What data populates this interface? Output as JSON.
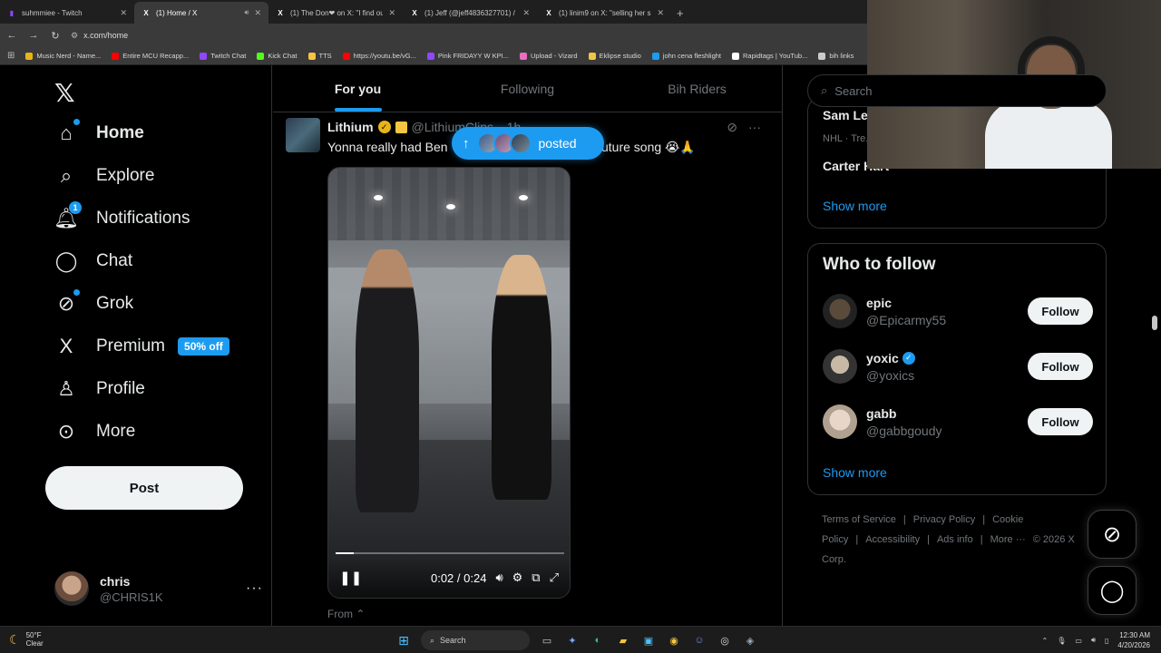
{
  "browser": {
    "tabs": [
      {
        "title": "suhmmiee - Twitch",
        "color": "#9146ff",
        "glyph": "▮"
      },
      {
        "title": "(1) Home / X",
        "color": "#ffffff",
        "glyph": "X",
        "active": true
      },
      {
        "title": "(1) The Don❤ on X: \"I find out",
        "color": "#ffffff",
        "glyph": "X"
      },
      {
        "title": "(1) Jeff (@jeff4836327701) / X",
        "color": "#ffffff",
        "glyph": "X"
      },
      {
        "title": "(1) linim9 on X: \"selling her sun",
        "color": "#ffffff",
        "glyph": "X"
      }
    ],
    "url": "x.com/home",
    "bookmarks": [
      {
        "label": "Music Nerd - Name...",
        "color": "#e8b417"
      },
      {
        "label": "Entire MCU Recapp...",
        "color": "#ff0000"
      },
      {
        "label": "Twitch Chat",
        "color": "#9146ff"
      },
      {
        "label": "Kick Chat",
        "color": "#53fc18"
      },
      {
        "label": "TTS",
        "color": "#f5c542"
      },
      {
        "label": "https://youtu.be/vG...",
        "color": "#ff0000"
      },
      {
        "label": "Pink FRIDAYY W KPI...",
        "color": "#9146ff"
      },
      {
        "label": "Upload - Vizard",
        "color": "#e86fbf"
      },
      {
        "label": "Eklipse studio",
        "color": "#f5c542"
      },
      {
        "label": "john cena fleshlight",
        "color": "#1d9bf0"
      },
      {
        "label": "Rapidtags | YouTub...",
        "color": "#ffffff"
      },
      {
        "label": "bih links",
        "color": "#cccccc"
      }
    ]
  },
  "nav": {
    "items": [
      {
        "label": "Home",
        "icon": "home-icon",
        "glyph": "⌂"
      },
      {
        "label": "Explore",
        "icon": "search-icon",
        "glyph": "⌕"
      },
      {
        "label": "Notifications",
        "icon": "bell-icon",
        "glyph": "🔔︎",
        "badge": "1"
      },
      {
        "label": "Chat",
        "icon": "chat-icon",
        "glyph": "◯"
      },
      {
        "label": "Grok",
        "icon": "grok-icon",
        "glyph": "⊘"
      },
      {
        "label": "Premium",
        "icon": "x-premium-icon",
        "glyph": "X"
      },
      {
        "label": "Profile",
        "icon": "person-icon",
        "glyph": "♙"
      },
      {
        "label": "More",
        "icon": "more-circle-icon",
        "glyph": "⊙"
      }
    ],
    "premium_badge": "50% off",
    "post_label": "Post",
    "account": {
      "name": "chris",
      "handle": "@CHRIS1K",
      "more": "···"
    }
  },
  "feed": {
    "tabs": [
      "For you",
      "Following",
      "Bih Riders"
    ],
    "posted_label": "posted",
    "tweet": {
      "name": "Lithium",
      "handle": "@LithiumClips",
      "time": "1h",
      "text_left": "Yonna really had Ben",
      "text_right": "uture song 😭🙏",
      "video_time": "0:02 / 0:24",
      "progress": 0.08,
      "from": "From ⌃"
    }
  },
  "sidebar": {
    "search_placeholder": "Search",
    "trend_top": "Sam Le...",
    "trend_sub": "NHL · Tre...",
    "trend_title": "Carter Hart",
    "show_more": "Show more",
    "who_to_follow": "Who to follow",
    "follow_label": "Follow",
    "suggestions": [
      {
        "name": "epic",
        "handle": "@Epicarmy55",
        "verified": false
      },
      {
        "name": "yoxic",
        "handle": "@yoxics",
        "verified": true
      },
      {
        "name": "gabb",
        "handle": "@gabbgoudy",
        "verified": false
      }
    ],
    "footer": [
      "Terms of Service",
      "|",
      "Privacy Policy",
      "|",
      "Cookie Policy",
      "|",
      "Accessibility",
      "|",
      "Ads info",
      "|",
      "More ···",
      "© 2026 X Corp."
    ]
  },
  "taskbar": {
    "temp": "50°F",
    "condition": "Clear",
    "search": "Search",
    "time": "12:30 AM",
    "date": "4/20/2026"
  }
}
